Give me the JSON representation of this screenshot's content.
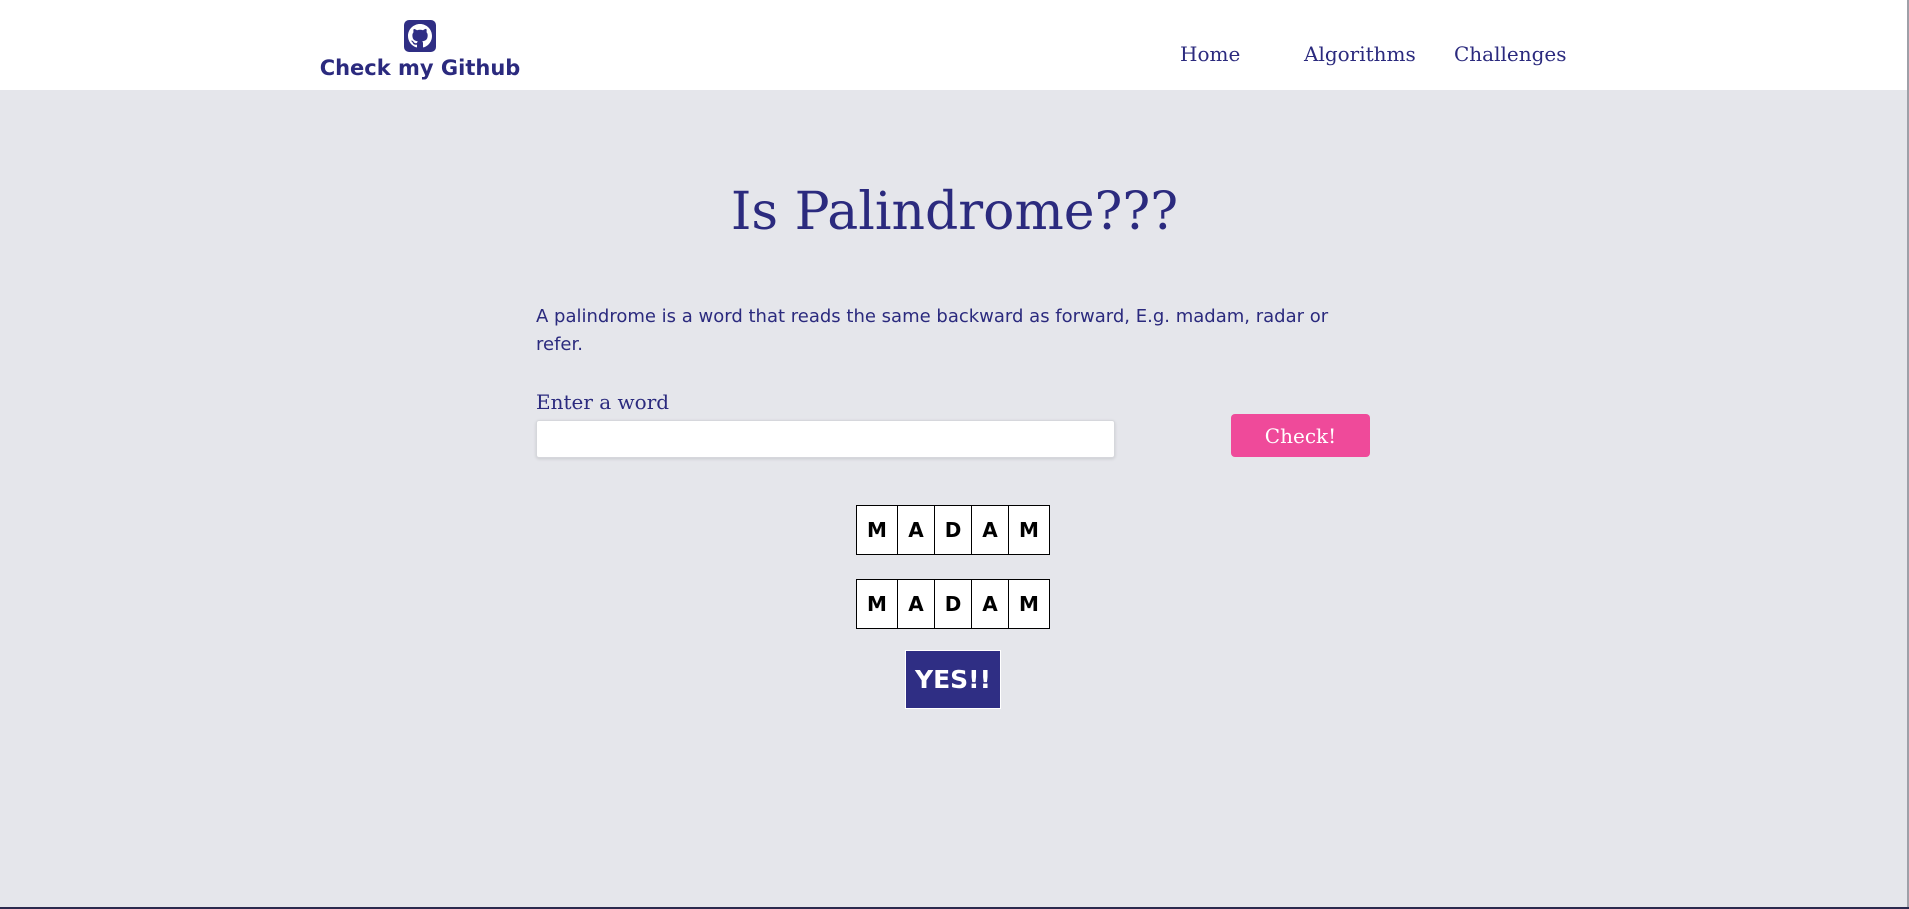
{
  "navbar": {
    "brand_label": "Check my Github",
    "brand_icon": "github-icon",
    "links": [
      {
        "label": "Home"
      },
      {
        "label": "Algorithms"
      },
      {
        "label": "Challenges"
      }
    ]
  },
  "main": {
    "title": "Is Palindrome???",
    "description": "A palindrome is a word that reads the same backward as forward, E.g. madam, radar or refer.",
    "input_label": "Enter a word",
    "input_value": "",
    "input_placeholder": "",
    "check_button_label": "Check!",
    "original_letters": [
      "M",
      "A",
      "D",
      "A",
      "M"
    ],
    "reversed_letters": [
      "M",
      "A",
      "D",
      "A",
      "M"
    ],
    "result": "YES!!"
  },
  "colors": {
    "primary": "#2b2a7e",
    "accent": "#ef4a9a",
    "background": "#e5e6eb",
    "navbar": "#ffffff"
  }
}
